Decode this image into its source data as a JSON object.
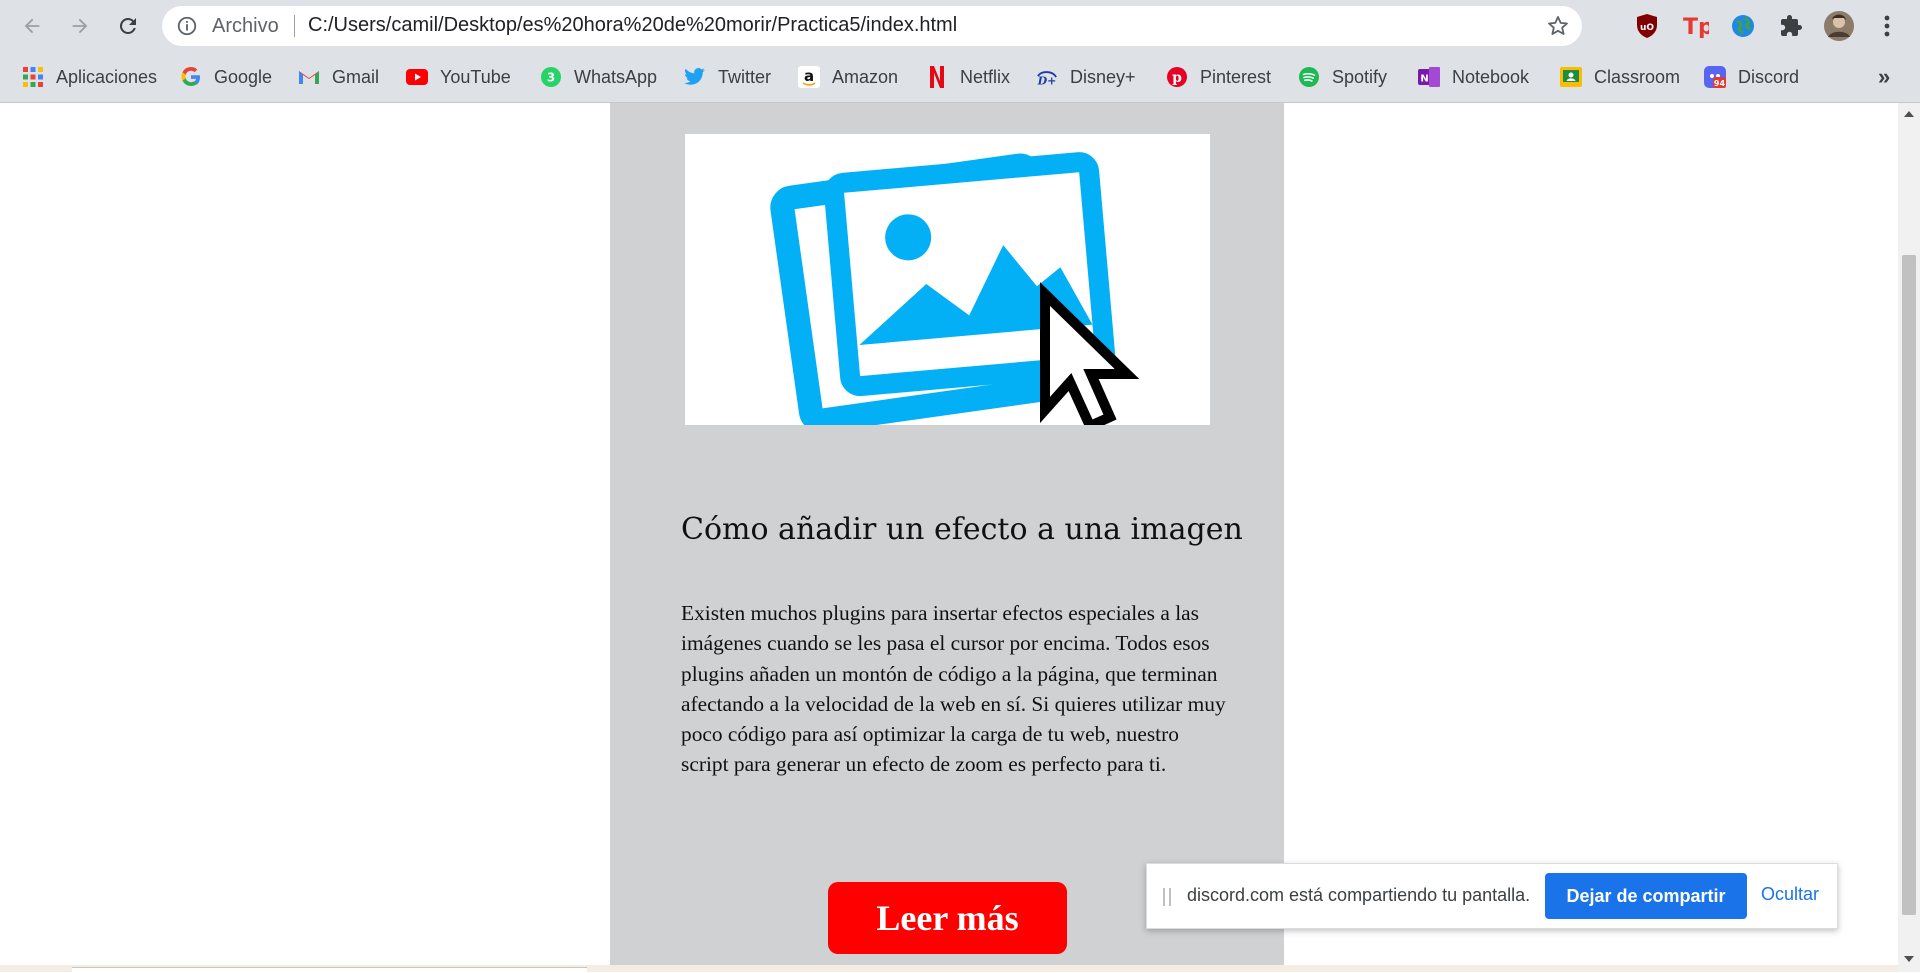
{
  "browser": {
    "scheme_label": "Archivo",
    "url": "C:/Users/camil/Desktop/es%20hora%20de%20morir/Practica5/index.html"
  },
  "bookmarks": [
    {
      "label": "Aplicaciones",
      "icon": "apps-grid-icon"
    },
    {
      "label": "Google",
      "icon": "google-icon"
    },
    {
      "label": "Gmail",
      "icon": "gmail-icon"
    },
    {
      "label": "YouTube",
      "icon": "youtube-icon"
    },
    {
      "label": "WhatsApp",
      "icon": "whatsapp-icon"
    },
    {
      "label": "Twitter",
      "icon": "twitter-icon"
    },
    {
      "label": "Amazon",
      "icon": "amazon-icon"
    },
    {
      "label": "Netflix",
      "icon": "netflix-icon"
    },
    {
      "label": "Disney+",
      "icon": "disney-icon"
    },
    {
      "label": "Pinterest",
      "icon": "pinterest-icon"
    },
    {
      "label": "Spotify",
      "icon": "spotify-icon"
    },
    {
      "label": "Notebook",
      "icon": "onenote-icon"
    },
    {
      "label": "Classroom",
      "icon": "classroom-icon"
    },
    {
      "label": "Discord",
      "icon": "discord-icon",
      "badge": "94"
    }
  ],
  "overflow_label": "»",
  "card": {
    "title": "Cómo añadir un efecto a una imagen",
    "text": "Existen muchos plugins para insertar efectos especiales a las imágenes cuando se les pasa el cursor por encima. Todos esos plugins añaden un montón de código a la página, que terminan afectando a la velocidad de la web en sí. Si quieres utilizar muy poco código para así optimizar la carga de tu web, nuestro script para generar un efecto de zoom es perfecto para ti.",
    "button_label": "Leer más",
    "image_icon": "picture-with-cursor-icon"
  },
  "share_notice": {
    "message": "discord.com está compartiendo tu pantalla.",
    "stop_label": "Dejar de compartir",
    "hide_label": "Ocultar"
  },
  "colors": {
    "card_bg": "#d0d1d3",
    "button_red": "#ff0000",
    "image_blue": "#03b0f5",
    "share_blue": "#1a73e8"
  }
}
